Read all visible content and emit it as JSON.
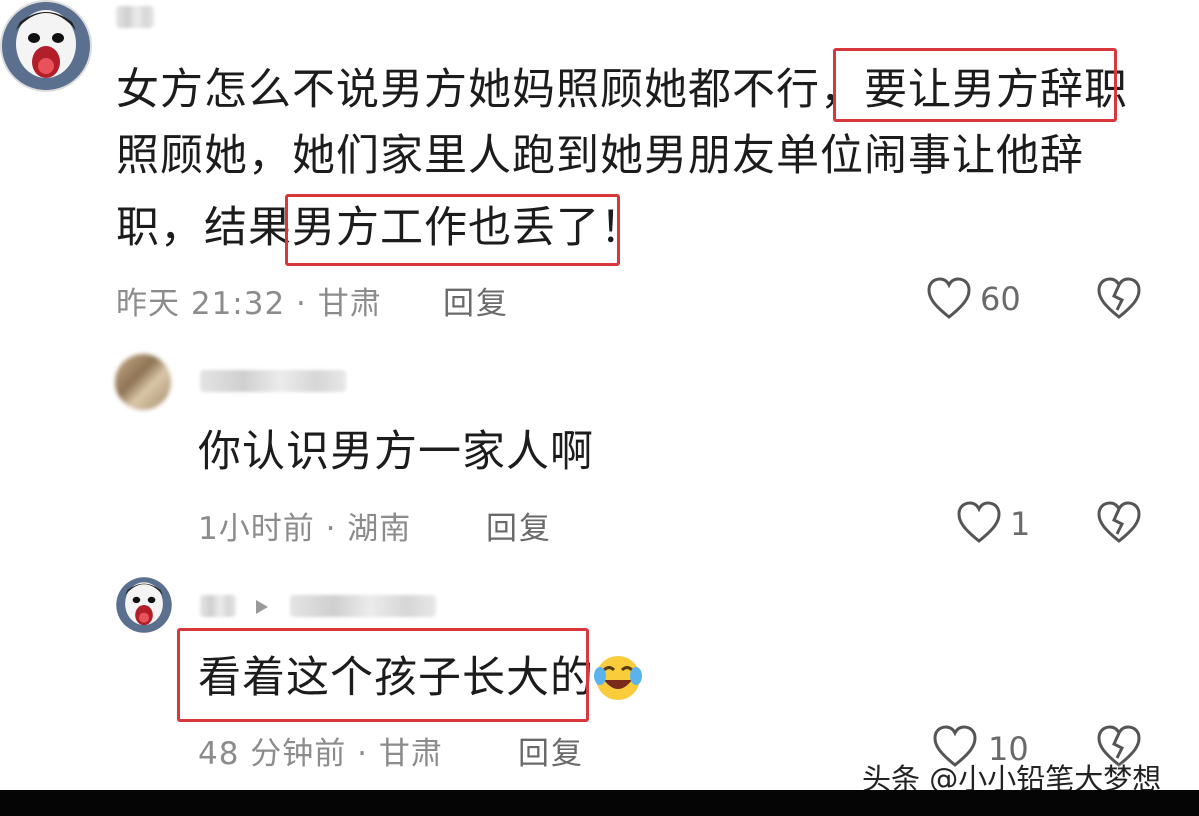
{
  "comment1": {
    "line1": "女方怎么不说男方她妈照顾她都不行，",
    "line1_hl": "要让男方辞职",
    "line2": "照顾她，她们家里人跑到她男朋友单位闹事让他辞",
    "line3a": "职，结果",
    "line3_hl": "男方工作也丢了！",
    "time": "昨天 21:32 · 甘肃",
    "reply": "回复",
    "likes": "60"
  },
  "comment2": {
    "text": "你认识男方一家人啊",
    "time": "1小时前 · 湖南",
    "reply": "回复",
    "likes": "1"
  },
  "comment3": {
    "text": "看着这个孩子长大的",
    "emoji": "laughing-crying-emoji",
    "time": "48 分钟前 · 甘肃",
    "reply": "回复",
    "likes": "10"
  },
  "watermark": "头条 @小小铅笔大梦想",
  "colors": {
    "highlight": "#d8373b",
    "meta": "#8c8c8c"
  }
}
